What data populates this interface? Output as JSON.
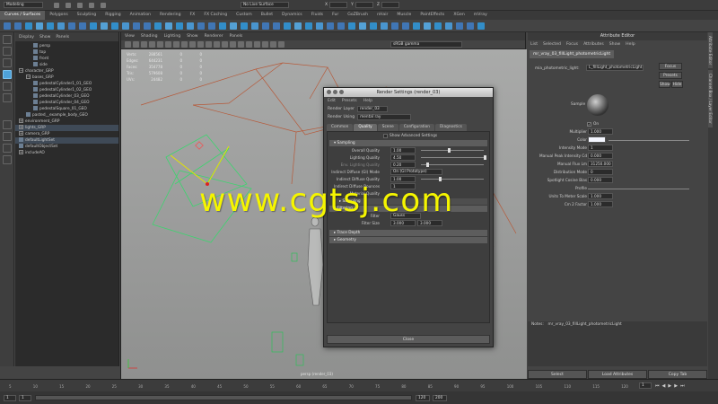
{
  "status_line": {
    "menu_set": "Modeling",
    "live_surface": "No Live Surface",
    "x_label": "X",
    "y_label": "Y",
    "z_label": "Z"
  },
  "shelf_tabs": [
    "Curves / Surfaces",
    "Polygons",
    "Sculpting",
    "Rigging",
    "Animation",
    "Rendering",
    "FX",
    "FX Caching",
    "Custom",
    "Bullet",
    "Dynamics",
    "Fluids",
    "Fur",
    "GoZBrush",
    "nHair",
    "Muscle",
    "PaintEffects",
    "XGen",
    "mVray"
  ],
  "outliner": {
    "menu": [
      "Display",
      "Show",
      "Panels"
    ],
    "items": [
      {
        "label": "persp",
        "indent": 2,
        "exp": ""
      },
      {
        "label": "top",
        "indent": 2,
        "exp": ""
      },
      {
        "label": "front",
        "indent": 2,
        "exp": ""
      },
      {
        "label": "side",
        "indent": 2,
        "exp": ""
      },
      {
        "label": "character_GRP",
        "indent": 0,
        "exp": "−"
      },
      {
        "label": "bases_GRP",
        "indent": 1,
        "exp": "−"
      },
      {
        "label": "pedestalCylinder1_01_GEO",
        "indent": 2,
        "exp": ""
      },
      {
        "label": "pedestalCylinder1_02_GEO",
        "indent": 2,
        "exp": ""
      },
      {
        "label": "pedestalCylinder_03_GEO",
        "indent": 2,
        "exp": ""
      },
      {
        "label": "pedestalCylinder_04_GEO",
        "indent": 2,
        "exp": ""
      },
      {
        "label": "pedestalSquare_01_GEO",
        "indent": 2,
        "exp": ""
      },
      {
        "label": "pasted__example_body_GEO",
        "indent": 1,
        "exp": ""
      },
      {
        "label": "environment_GRP",
        "indent": 0,
        "exp": "+"
      },
      {
        "label": "lights_GRP",
        "indent": 0,
        "exp": "+"
      },
      {
        "label": "camera_GRP",
        "indent": 0,
        "exp": "+"
      },
      {
        "label": "defaultLightSet",
        "indent": 0,
        "exp": ""
      },
      {
        "label": "defaultObjectSet",
        "indent": 0,
        "exp": ""
      },
      {
        "label": "includeAO",
        "indent": 0,
        "exp": "+"
      }
    ]
  },
  "viewport": {
    "menu": [
      "View",
      "Shading",
      "Lighting",
      "Show",
      "Renderer",
      "Panels"
    ],
    "color_space": "sRGB gamma",
    "hud_labels": [
      "Verts:",
      "Edges:",
      "Faces:",
      "Tris:",
      "UVs:"
    ],
    "hud_values": [
      "288561",
      "644231",
      "354778",
      "579608",
      "24482"
    ],
    "hud_zero": "0",
    "camera_label": "persp (render_03)"
  },
  "render_settings": {
    "title": "Render Settings (render_03)",
    "menu": [
      "Edit",
      "Presets",
      "Help"
    ],
    "render_layer_label": "Render Layer",
    "render_layer_value": "render_03",
    "render_using_label": "Render Using",
    "render_using_value": "mental ray",
    "tabs": [
      "Common",
      "Quality",
      "Scene",
      "Configuration",
      "Diagnostics"
    ],
    "show_advanced": "Show Advanced Settings",
    "sampling_header": "Sampling",
    "fields": [
      {
        "label": "Overall Quality",
        "value": "1.00"
      },
      {
        "label": "Lighting Quality",
        "value": "4.50"
      },
      {
        "label": "Env. Lighting Quality",
        "value": "0.20"
      }
    ],
    "indirect_mode_label": "Indirect Diffuse (GI) Mode",
    "indirect_mode_value": "On (GI Prototype)",
    "indirect_quality_label": "Indirect Diffuse Quality",
    "indirect_quality_value": "1.00",
    "indirect_bounces_label": "Indirect Diffuse Bounces",
    "indirect_bounces_value": "1",
    "mat_label": "Material Quality",
    "sub_sampling": "Sampling",
    "filtering_header": "Filtering",
    "filter_label": "Filter",
    "filter_value": "Gauss",
    "filter_size_label": "Filter Size",
    "filter_size_x": "3.000",
    "filter_size_y": "3.000",
    "trace_depth": "Trace Depth",
    "geometry": "Geometry",
    "close": "Close"
  },
  "attribute_editor": {
    "title": "Attribute Editor",
    "menu": [
      "List",
      "Selected",
      "Focus",
      "Attributes",
      "Show",
      "Help"
    ],
    "node_tab": "mr_vray_03_fillLight_photometricLight",
    "node_label": "mia_photometric_light:",
    "node_value": "L_fillLight_photometricLight",
    "focus": "Focus",
    "presets": "Presets",
    "show": "Show",
    "hide": "Hide",
    "sample_label": "Sample",
    "on_label": "On",
    "rows": [
      {
        "label": "Multiplier",
        "value": "1.000"
      },
      {
        "label": "Color",
        "value": ""
      },
      {
        "label": "Intensity Mode",
        "value": "1"
      },
      {
        "label": "Manual Peak Intensity Cd",
        "value": "0.000"
      },
      {
        "label": "Manual Flux Lm",
        "value": "31250.000"
      },
      {
        "label": "Distribution Mode",
        "value": "0"
      },
      {
        "label": "Spotlight Cosine Bias",
        "value": "0.000"
      },
      {
        "label": "Profile",
        "value": ""
      },
      {
        "label": "Units To Meter Scale",
        "value": "1.000"
      },
      {
        "label": "Cm 2 Factor",
        "value": "1.000"
      }
    ],
    "notes_label": "Notes:",
    "notes_value": "mr_vray_03_fillLight_photometricLight",
    "bottom_buttons": [
      "Select",
      "Load Attributes",
      "Copy Tab"
    ],
    "side_tabs": [
      "Attribute Editor",
      "Channel Box / Layer Editor"
    ]
  },
  "timeline": {
    "ticks": [
      "5",
      "10",
      "15",
      "20",
      "25",
      "30",
      "35",
      "40",
      "45",
      "50",
      "55",
      "60",
      "65",
      "70",
      "75",
      "80",
      "85",
      "90",
      "95",
      "100",
      "105",
      "110",
      "115",
      "120"
    ],
    "current_frame": "1"
  },
  "range": {
    "start": "1",
    "playback_start": "1",
    "playback_end": "120",
    "end": "200"
  },
  "watermark": "www.cgtsj.com",
  "colors": {
    "accent": "#4ea2d9",
    "viewport_bg": "#9ea0a0",
    "light_gizmo": "#3dd46f",
    "camera_lines": "#b65a3a",
    "watermark": "#f5f500"
  }
}
